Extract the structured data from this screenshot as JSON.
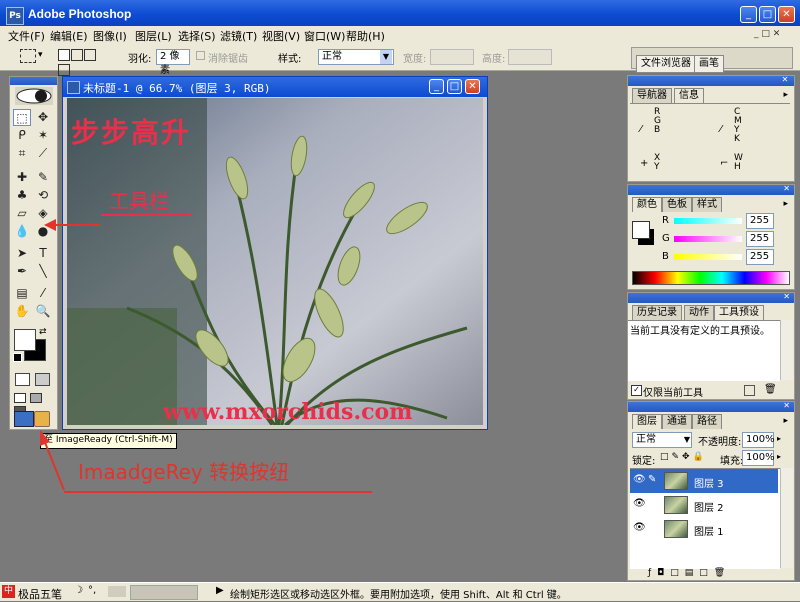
{
  "window": {
    "title": "Adobe Photoshop"
  },
  "menu": [
    "文件(F)",
    "编辑(E)",
    "图像(I)",
    "图层(L)",
    "选择(S)",
    "滤镜(T)",
    "视图(V)",
    "窗口(W)",
    "帮助(H)"
  ],
  "options": {
    "feather_label": "羽化:",
    "feather_value": "2 像素",
    "antialias_label": "消除锯齿",
    "style_label": "样式:",
    "style_value": "正常",
    "width_label": "宽度:",
    "height_label": "高度:",
    "file_browser_tab": "文件浏览器",
    "brush_tab": "画笔"
  },
  "document": {
    "title": "未标题-1 @ 66.7% (图层 3, RGB)",
    "caption_top": "步步高升",
    "caption_mid": "工具栏",
    "watermark": "www.mxorchids.com"
  },
  "toolbox": {
    "tooltip": "至 ImageReady (Ctrl-Shift-M)"
  },
  "annotation": {
    "label": "ImaadgeRey 转换按纽"
  },
  "nav_panel": {
    "tabs": [
      "导航器",
      "信息"
    ],
    "rgb": [
      "R",
      "G",
      "B"
    ],
    "cmyk": [
      "C",
      "M",
      "Y",
      "K"
    ],
    "xy": [
      "X",
      "Y"
    ],
    "wh": [
      "W",
      "H"
    ]
  },
  "color_panel": {
    "tabs": [
      "颜色",
      "色板",
      "样式"
    ],
    "channels": [
      {
        "label": "R",
        "value": "255",
        "color": "#00e0e0"
      },
      {
        "label": "G",
        "value": "255",
        "color": "#e000e0"
      },
      {
        "label": "B",
        "value": "255",
        "color": "#e0e000"
      }
    ]
  },
  "history_panel": {
    "tabs": [
      "历史记录",
      "动作",
      "工具预设"
    ],
    "message": "当前工具没有定义的工具预设。",
    "checkbox_label": "仅限当前工具"
  },
  "layers_panel": {
    "tabs": [
      "图层",
      "通道",
      "路径"
    ],
    "blend_mode": "正常",
    "opacity_label": "不透明度:",
    "opacity_value": "100%",
    "lock_label": "锁定:",
    "fill_label": "填充:",
    "fill_value": "100%",
    "layers": [
      {
        "name": "图层 3",
        "selected": true
      },
      {
        "name": "图层 2",
        "selected": false
      },
      {
        "name": "图层 1",
        "selected": false
      }
    ]
  },
  "status": {
    "ime": "极品五笔",
    "message": "绘制矩形选区或移动选区外框。要用附加选项，使用 Shift、Alt 和 Ctrl 键。"
  },
  "colors": {
    "title_blue": "#0c4bd2",
    "annotation_red": "#e0342e",
    "layer_selected": "#3169c6"
  }
}
